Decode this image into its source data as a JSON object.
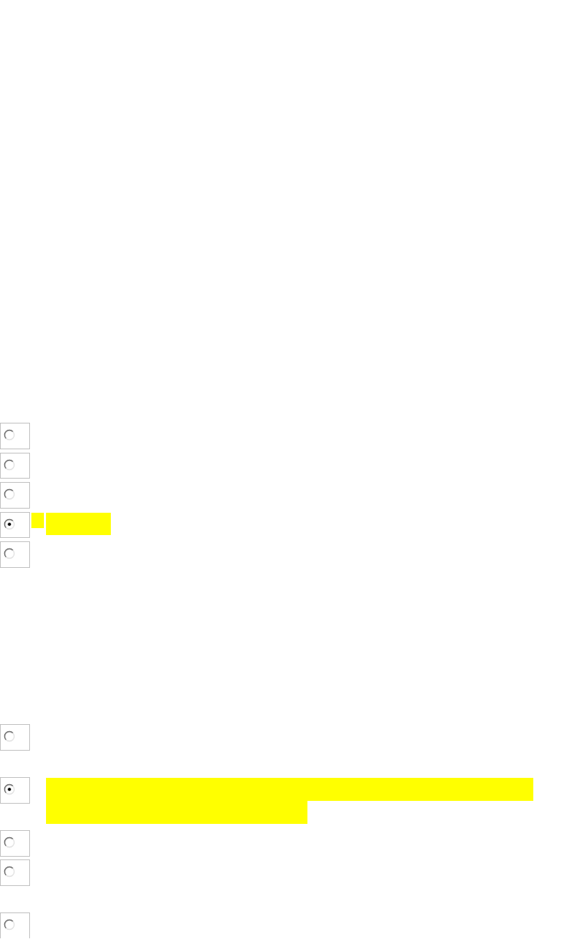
{
  "questions": [
    {
      "options": [
        {
          "selected": false
        },
        {
          "selected": false
        },
        {
          "selected": false
        },
        {
          "selected": true
        },
        {
          "selected": false
        }
      ]
    },
    {
      "options": [
        {
          "selected": false
        },
        {
          "selected": true
        },
        {
          "selected": false
        },
        {
          "selected": false
        },
        {
          "selected": false
        }
      ]
    }
  ]
}
